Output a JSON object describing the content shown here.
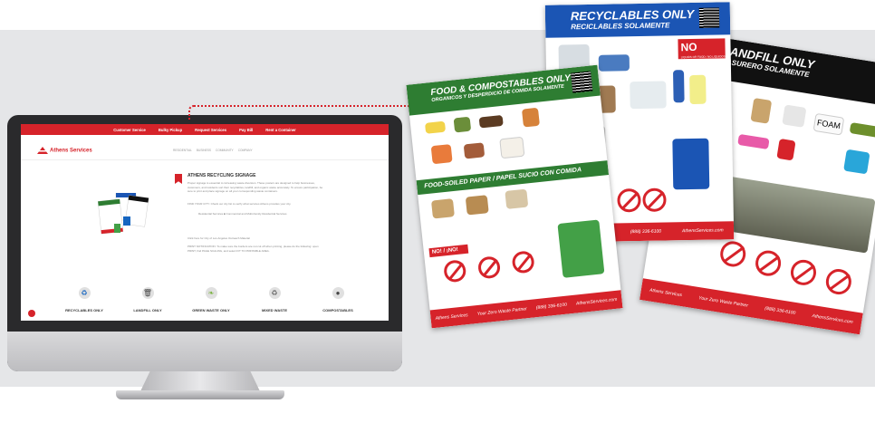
{
  "website": {
    "top_links": [
      "Customer Service",
      "Bulky Pickup",
      "Request Services",
      "Pay Bill",
      "Rent a Container"
    ],
    "logo_text": "Athens Services",
    "nav_items": [
      "RESIDENTIAL",
      "BUSINESS",
      "COMMUNITY",
      "COMPANY"
    ],
    "section_title": "ATHENS RECYCLING SIGNAGE",
    "intro": "Proper signage is essential to increasing waste diversion. These posters are designed to help businesses, customers, and residents sort their recyclables, landfill, and organic waste accurately. To ensure participation, be sure to print and place signage on all your corresponding waste containers.",
    "find_city": "FIND YOUR CITY: Check our city list to verify what services Athens provides your city.",
    "options": [
      "Residential Services",
      "Commercial and Multi-Family Residential Services"
    ],
    "click_here": "Click here for City of Los Angeles Outreach Material",
    "print_note": "PRINT NOTIFICATION: To make sure the borders are not cut off when printing, please do the following: open PRINT, find PAGE SCALING, and select FIT TO PRINTABLE AREA.",
    "categories": [
      {
        "label": "RECYCLABLES ONLY",
        "icon": "recycle-icon",
        "color": "#1565c0"
      },
      {
        "label": "LANDFILL ONLY",
        "icon": "trash-icon",
        "color": "#444444"
      },
      {
        "label": "GREEN WASTE ONLY",
        "icon": "leaf-icon",
        "color": "#7cb342"
      },
      {
        "label": "MIXED WASTE",
        "icon": "recycle-icon",
        "color": "#666666"
      },
      {
        "label": "COMPOSTABLES",
        "icon": "apple-icon",
        "color": "#444444"
      }
    ]
  },
  "posters": {
    "recyclables": {
      "title": "RECYCLABLES ONLY",
      "subtitle": "RECICLABLES SOLAMENTE",
      "no_text": "NO",
      "no_detail": "LIQUIDS OR FOOD / NO LIQUIDOS O COMIDA",
      "color": "#1b55b4"
    },
    "landfill": {
      "title": "LANDFILL ONLY",
      "subtitle": "BASURERO SOLAMENTE",
      "foam": "FOAM",
      "color": "#111111"
    },
    "food": {
      "title": "FOOD & COMPOSTABLES ONLY",
      "subtitle": "ORGANICOS Y DESPERDICIO DE COMIDA SOLAMENTE",
      "section": "FOOD-SOILED PAPER / PAPEL SUCIO CON COMIDA",
      "no": "NO! / ¡NO!",
      "color": "#2e7d32"
    },
    "footer": {
      "brand": "Athens Services",
      "slogan": "Your Zero Waste Partner",
      "phone": "(888) 336-6100",
      "site": "AthensServices.com"
    }
  }
}
